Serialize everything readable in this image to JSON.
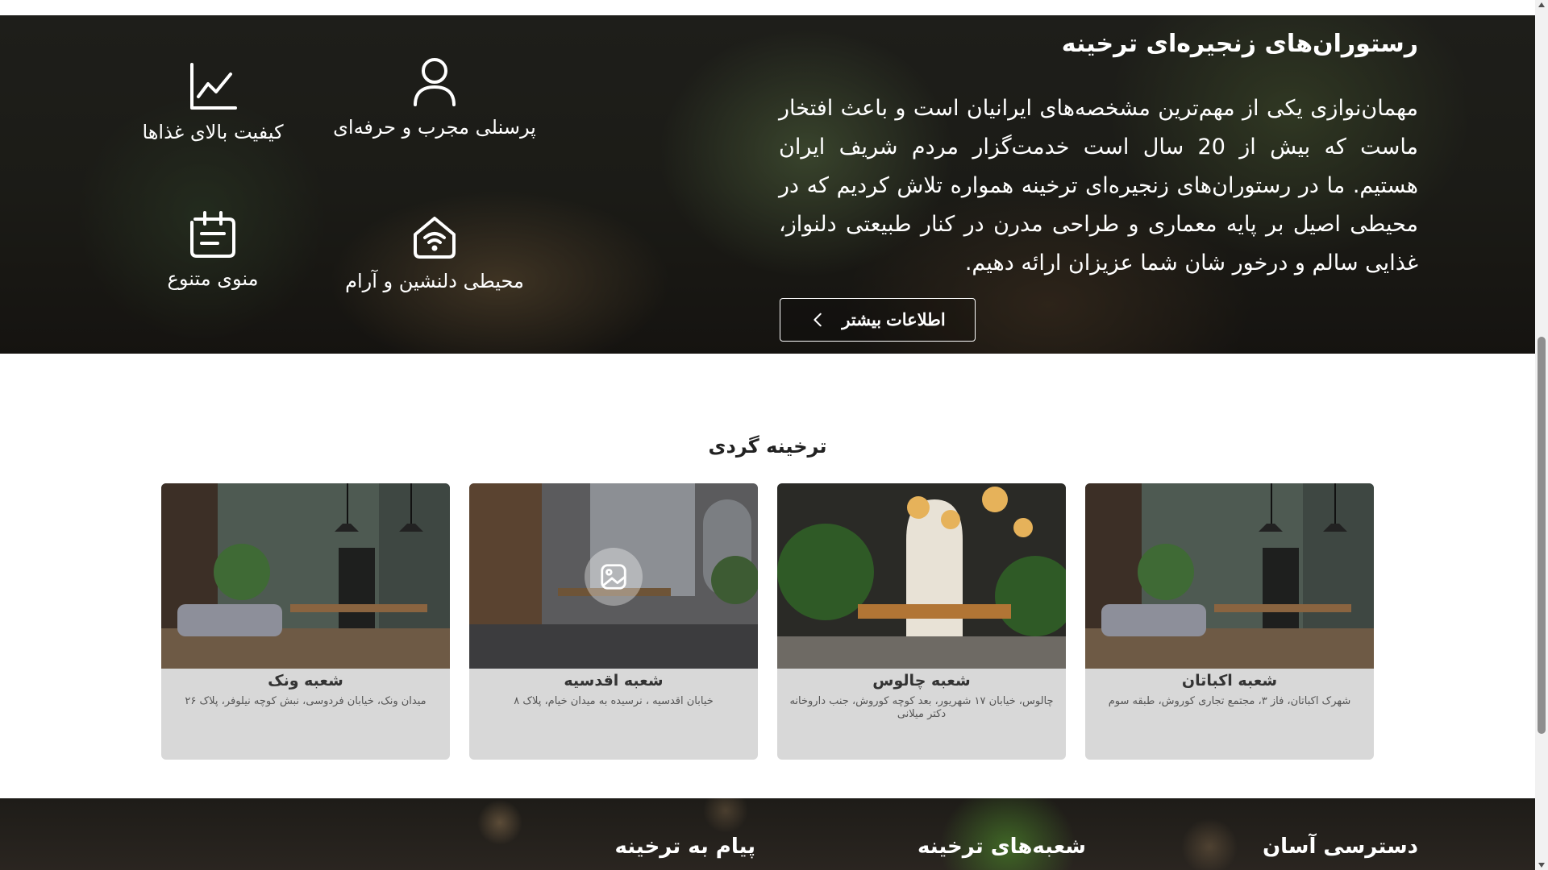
{
  "hero": {
    "title": "رستوران‌های زنجیره‌ای ترخینه",
    "paragraph": "مهمان‌نوازی یکی از مهم‌ترین مشخصه‌های ایرانیان است و باعث افتخار ماست که بیش از 20 سال است خدمت‌گزار مردم شریف ایران هستیم. ما در رستوران‌های زنجیره‌ای ترخینه همواره تلاش کردیم که در محیطی اصیل بر پایه معماری و طراحی مدرن در کنار طبیعتی دلنواز، غذایی سالم و درخور شان شما عزیزان ارائه دهیم.",
    "button_label": "اطلاعات بیشتر",
    "features": {
      "staff": {
        "label": "پرسنلی مجرب و حرفه‌ای",
        "icon": "user-icon"
      },
      "quality": {
        "label": "کیفیت بالای غذاها",
        "icon": "chart-line-icon"
      },
      "ambience": {
        "label": "محیطی دلنشین و آرام",
        "icon": "home-wifi-icon"
      },
      "menu": {
        "label": "منوی متنوع",
        "icon": "menu-board-icon"
      }
    }
  },
  "tour": {
    "title": "ترخینه گردی",
    "branches": [
      {
        "name": "شعبه اکباتان",
        "address": "شهرک اکباتان، فاز ۳، مجتمع تجاری کوروش، طبقه سوم"
      },
      {
        "name": "شعبه چالوس",
        "address": "چالوس، خیابان ۱۷ شهریور، بعد کوچه کوروش، جنب داروخانه دکتر میلانی"
      },
      {
        "name": "شعبه اقدسیه",
        "address": "خیابان اقدسیه ، نرسیده به میدان خیام، پلاک ۸"
      },
      {
        "name": "شعبه ونک",
        "address": "میدان ونک، خیابان فردوسی، نبش کوچه نیلوفر، پلاک ۲۶"
      }
    ]
  },
  "footer": {
    "columns": [
      "دسترسی آسان",
      "شعبه‌های ترخینه",
      "پیام به ترخینه"
    ]
  },
  "colors": {
    "card_bg": "#d8d8d8",
    "text_dark": "#222222",
    "footer_bg": "#1e1c18"
  }
}
